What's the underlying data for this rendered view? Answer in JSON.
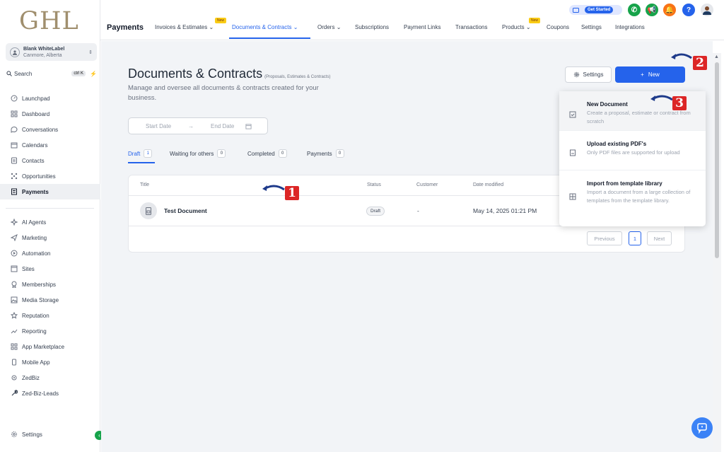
{
  "brand": {
    "logo": "GHL"
  },
  "account": {
    "name": "Blank WhiteLabel",
    "location": "Canmore, Alberta"
  },
  "search": {
    "label": "Search",
    "shortcut": "ctrl K"
  },
  "sidebar": {
    "items": [
      {
        "label": "Launchpad",
        "icon": "rocket-icon"
      },
      {
        "label": "Dashboard",
        "icon": "grid-icon"
      },
      {
        "label": "Conversations",
        "icon": "chat-icon"
      },
      {
        "label": "Calendars",
        "icon": "calendar-icon"
      },
      {
        "label": "Contacts",
        "icon": "contacts-icon"
      },
      {
        "label": "Opportunities",
        "icon": "funnel-icon"
      },
      {
        "label": "Payments",
        "icon": "payments-icon"
      },
      {
        "label": "AI Agents",
        "icon": "sparkle-icon"
      },
      {
        "label": "Marketing",
        "icon": "send-icon"
      },
      {
        "label": "Automation",
        "icon": "automation-icon"
      },
      {
        "label": "Sites",
        "icon": "sites-icon"
      },
      {
        "label": "Memberships",
        "icon": "badge-icon"
      },
      {
        "label": "Media Storage",
        "icon": "image-icon"
      },
      {
        "label": "Reputation",
        "icon": "star-icon"
      },
      {
        "label": "Reporting",
        "icon": "trend-icon"
      },
      {
        "label": "App Marketplace",
        "icon": "apps-icon"
      },
      {
        "label": "Mobile App",
        "icon": "mobile-icon"
      },
      {
        "label": "ZedBiz",
        "icon": "globe-icon"
      },
      {
        "label": "Zed-Biz-Leads",
        "icon": "wrench-icon"
      }
    ],
    "settings_label": "Settings"
  },
  "topbar": {
    "section_title": "Payments",
    "tabs": [
      {
        "label": "Invoices & Estimates"
      },
      {
        "label": "Documents & Contracts"
      },
      {
        "label": "Orders"
      },
      {
        "label": "Subscriptions"
      },
      {
        "label": "Payment Links"
      },
      {
        "label": "Transactions"
      },
      {
        "label": "Products"
      },
      {
        "label": "Coupons"
      },
      {
        "label": "Settings"
      },
      {
        "label": "Integrations"
      }
    ],
    "new_badge": "New",
    "get_started": "Get Started",
    "help": "?"
  },
  "page": {
    "title": "Documents & Contracts",
    "title_note": "(Proposals, Estimates & Contracts)",
    "subtitle": "Manage and oversee all documents & contracts created for your business.",
    "settings_button": "Settings",
    "new_button": "New",
    "start_date_placeholder": "Start Date",
    "end_date_placeholder": "End Date"
  },
  "doc_tabs": [
    {
      "label": "Draft",
      "count": "1"
    },
    {
      "label": "Waiting for others",
      "count": "0"
    },
    {
      "label": "Completed",
      "count": "0"
    },
    {
      "label": "Payments",
      "count": "0"
    }
  ],
  "table": {
    "columns": [
      "Title",
      "Status",
      "Customer",
      "Date modified"
    ],
    "rows": [
      {
        "title": "Test Document",
        "status": "Draft",
        "customer": "-",
        "date_modified": "May 14, 2025 01:21 PM"
      }
    ],
    "pagination": {
      "previous": "Previous",
      "page": "1",
      "next": "Next"
    }
  },
  "new_menu": [
    {
      "title": "New Document",
      "desc": "Create a proposal, estimate or contract from scratch"
    },
    {
      "title": "Upload existing PDF's",
      "desc": "Only PDF files are supported for upload"
    },
    {
      "title": "Import from template library",
      "desc": "Import a document from a large collection of templates from the template library."
    }
  ],
  "annotations": {
    "marker_1": "1",
    "marker_2": "2",
    "marker_3": "3"
  },
  "colors": {
    "accent": "#2563eb",
    "marker": "#dc2626",
    "logo": "#a08f6e"
  }
}
